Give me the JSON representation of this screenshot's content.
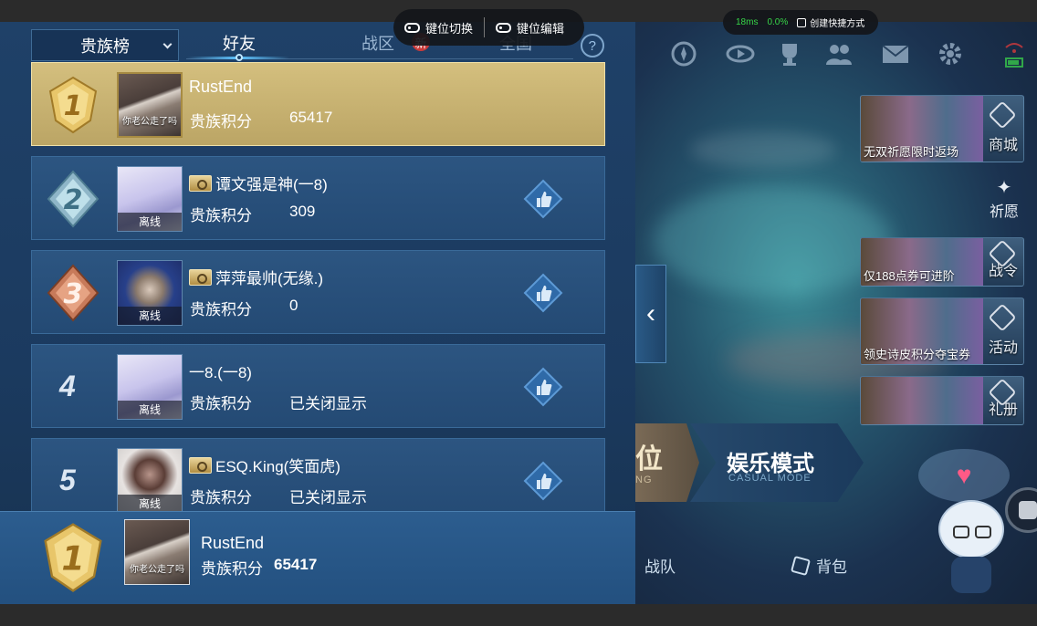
{
  "emulator": {
    "key_switch_label": "键位切换",
    "key_edit_label": "键位编辑",
    "ping": "18ms",
    "loss": "0.0%",
    "shortcut_label": "创建快捷方式"
  },
  "leaderboard": {
    "dropdown_label": "贵族榜",
    "tabs": [
      {
        "label": "好友",
        "active": true
      },
      {
        "label": "战区",
        "active": false
      },
      {
        "label": "全国",
        "active": false
      }
    ],
    "new_badge": "新",
    "help_icon": "?",
    "score_label": "贵族积分",
    "rows": [
      {
        "rank": "1",
        "name": "RustEnd",
        "score": "65417",
        "avatar_caption": "你老公走了吗",
        "noble_icon": false,
        "status": "",
        "highlight": true
      },
      {
        "rank": "2",
        "name": "谭文强是神(一8)",
        "score": "309",
        "avatar_caption": "",
        "noble_icon": true,
        "status": "离线",
        "highlight": false
      },
      {
        "rank": "3",
        "name": "萍萍最帅(无缘.)",
        "score": "0",
        "avatar_caption": "",
        "noble_icon": true,
        "status": "离线",
        "highlight": false
      },
      {
        "rank": "4",
        "name": "一8.(一8)",
        "score": "已关闭显示",
        "avatar_caption": "",
        "noble_icon": false,
        "status": "离线",
        "highlight": false
      },
      {
        "rank": "5",
        "name": "ESQ.King(笑面虎)",
        "score": "已关闭显示",
        "avatar_caption": "",
        "noble_icon": true,
        "status": "离线",
        "highlight": false
      }
    ],
    "self": {
      "rank": "1",
      "name": "RustEnd",
      "score_label": "贵族积分",
      "score": "65417",
      "avatar_caption": "你老公走了吗"
    }
  },
  "game": {
    "side_cards": [
      {
        "caption": "无双祈愿限时返场",
        "label": "商城"
      },
      {
        "caption": "仅188点券可进阶",
        "label": "战令"
      },
      {
        "caption": "领史诗皮积分夺宝券",
        "label": "活动"
      },
      {
        "caption": "",
        "label": "礼册"
      }
    ],
    "wish_label": "祈愿",
    "mode_rank_text": "位",
    "mode_rank_sub": "NG",
    "mode_casual_title": "娱乐模式",
    "mode_casual_sub": "CASUAL MODE",
    "nav_team": "战队",
    "nav_bag": "背包",
    "heart": "♥",
    "collapse_arrow": "‹"
  },
  "colors": {
    "panel_bg": "#1f4168",
    "row_bg": "#2c5581",
    "first_row_gold": "#d4bf7e",
    "online_green": "#37d649",
    "new_badge_red": "#c93a3a"
  }
}
